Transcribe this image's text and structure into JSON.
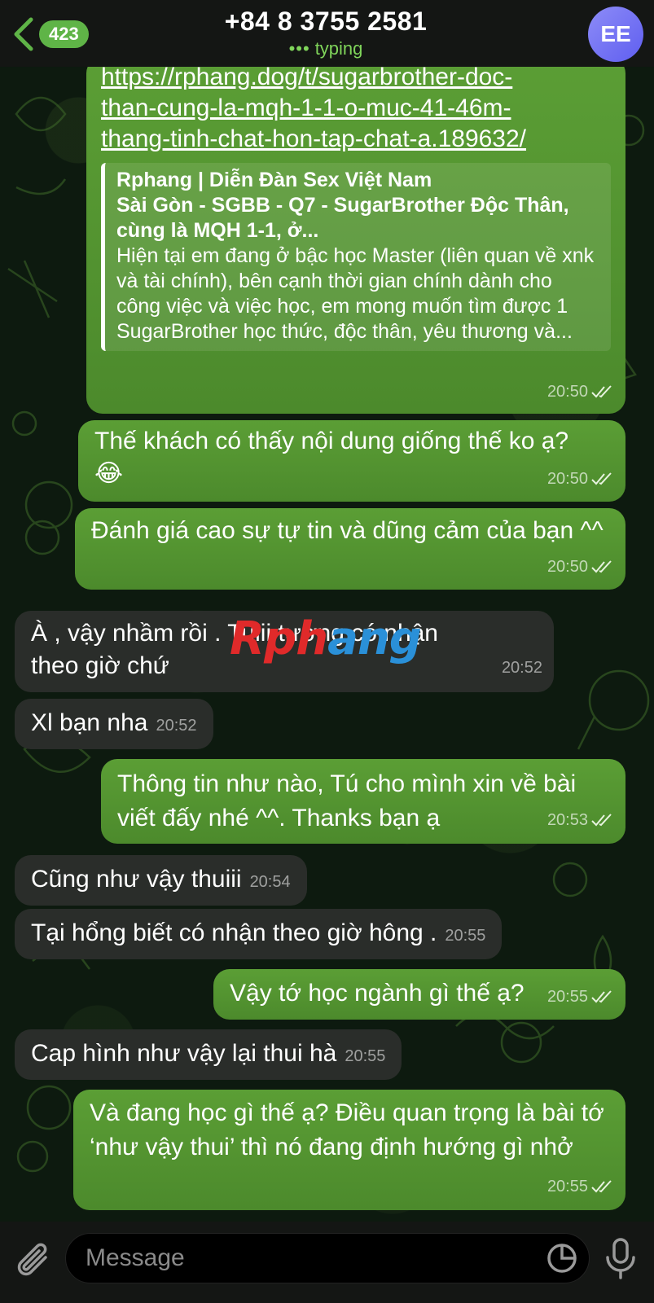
{
  "header": {
    "back_count": "423",
    "contact_name": "+84 8 3755 2581",
    "status_dots": "•••",
    "status": "typing",
    "avatar_initials": "EE"
  },
  "messages": [
    {
      "dir": "out",
      "link": "https://rphang.dog/t/sugarbrother-doc-than-cung-la-mqh-1-1-o-muc-41-46m-thang-tinh-chat-hon-tap-chat-a.189632/",
      "link_lines": [
        "https://rphang.dog/t/sugarbrother-doc-",
        "than-cung-la-mqh-1-1-o-muc-41-46m-",
        "thang-tinh-chat-hon-tap-chat-a.189632/"
      ],
      "preview_site": "Rphang | Diễn Đàn Sex Việt Nam",
      "preview_title": "Sài Gòn - SGBB - Q7 - SugarBrother Độc Thân, cùng là MQH 1-1, ở...",
      "preview_desc": "Hiện tại em đang ở bậc học Master (liên quan về xnk và tài chính), bên cạnh thời gian chính dành cho công việc và việc học, em mong muốn tìm được 1 SugarBrother học thức, độc thân, yêu thương và...",
      "time": "20:50"
    },
    {
      "dir": "out",
      "text": "Thế khách có thấy nội dung giống thế ko ạ?",
      "emoji": "😂",
      "time": "20:50"
    },
    {
      "dir": "out",
      "text": "Đánh giá cao sự tự tin và dũng cảm của bạn ^^",
      "time": "20:50"
    },
    {
      "dir": "in",
      "text": "À , vậy nhầm rồi . Tuiii tưởng có nhận theo giờ chứ",
      "time": "20:52"
    },
    {
      "dir": "in",
      "text": "Xl bạn nha",
      "time": "20:52"
    },
    {
      "dir": "out",
      "text": "Thông tin như nào, Tú cho mình xin về bài viết đấy nhé ^^. Thanks bạn ạ",
      "time": "20:53"
    },
    {
      "dir": "in",
      "text": "Cũng như vậy thuiii",
      "time": "20:54"
    },
    {
      "dir": "in",
      "text": "Tại hổng biết có nhận theo giờ hông .",
      "time": "20:55"
    },
    {
      "dir": "out",
      "text": "Vậy tớ học ngành gì thế ạ?",
      "time": "20:55"
    },
    {
      "dir": "in",
      "text": "Cap hình như vậy lại thui hà",
      "time": "20:55"
    },
    {
      "dir": "out",
      "text": "Và đang học gì thế ạ? Điều quan trọng là bài tớ ‘như vậy thui’ thì nó đang định hướng gì nhở",
      "time": "20:55"
    }
  ],
  "watermark": {
    "part1": "Rph",
    "part2": "ang"
  },
  "composer": {
    "placeholder": "Message"
  },
  "colors": {
    "outgoing": "#5b9e35",
    "incoming": "#2a2d2a",
    "accent": "#5fb447",
    "avatar": "#6f6ef3"
  },
  "icons": [
    "back-chevron-icon",
    "double-check-icon",
    "paperclip-icon",
    "sticker-icon",
    "microphone-icon"
  ]
}
